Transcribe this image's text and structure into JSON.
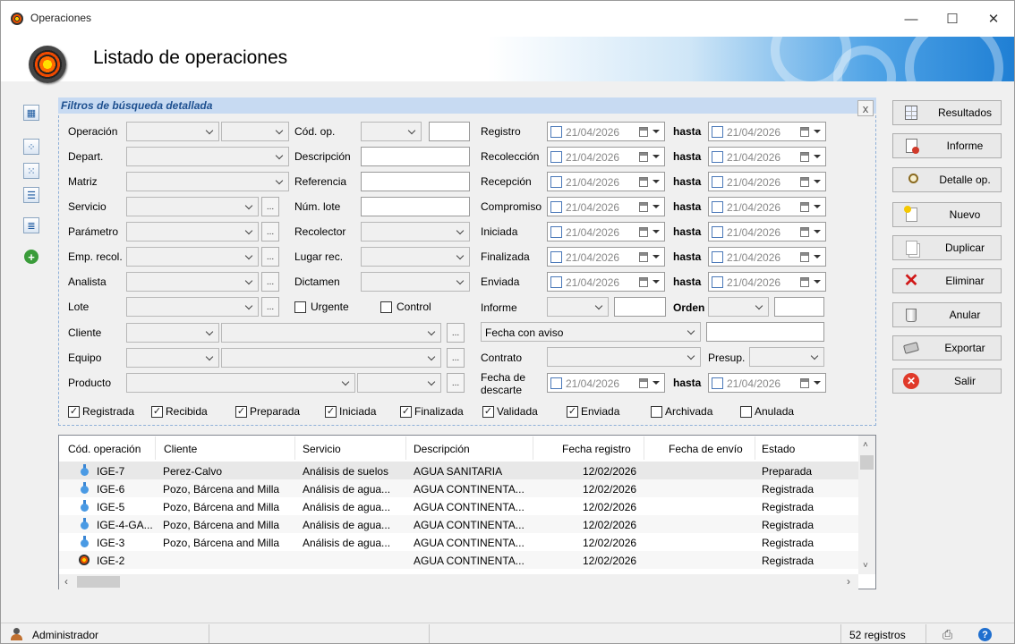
{
  "window": {
    "title": "Operaciones",
    "banner_title": "Listado de operaciones",
    "minimize": "—",
    "maximize": "☐",
    "close": "✕"
  },
  "filters": {
    "title": "Filtros de búsqueda detallada",
    "close": "x",
    "labels": {
      "operacion": "Operación",
      "depart": "Depart.",
      "matriz": "Matriz",
      "servicio": "Servicio",
      "parametro": "Parámetro",
      "emp_recol": "Emp. recol.",
      "analista": "Analista",
      "lote": "Lote",
      "cliente": "Cliente",
      "equipo": "Equipo",
      "producto": "Producto",
      "cod_op": "Cód. op.",
      "descripcion": "Descripción",
      "referencia": "Referencia",
      "num_lote": "Núm. lote",
      "recolector": "Recolector",
      "lugar_rec": "Lugar rec.",
      "dictamen": "Dictamen",
      "urgente": "Urgente",
      "control": "Control",
      "registro": "Registro",
      "recoleccion": "Recolección",
      "recepcion": "Recepción",
      "compromiso": "Compromiso",
      "iniciada": "Iniciada",
      "finalizada": "Finalizada",
      "enviada": "Enviada",
      "informe": "Informe",
      "orden": "Orden",
      "contrato": "Contrato",
      "presup": "Presup.",
      "fecha_descarte_1": "Fecha de",
      "fecha_descarte_2": "descarte",
      "hasta": "hasta"
    },
    "ellipsis": "...",
    "date_value": "21/04/2026",
    "fecha_con_aviso": "Fecha con aviso",
    "status_checks": [
      {
        "label": "Registrada",
        "checked": true
      },
      {
        "label": "Recibida",
        "checked": true
      },
      {
        "label": "Preparada",
        "checked": true
      },
      {
        "label": "Iniciada",
        "checked": true
      },
      {
        "label": "Finalizada",
        "checked": true
      },
      {
        "label": "Validada",
        "checked": true
      },
      {
        "label": "Enviada",
        "checked": true
      },
      {
        "label": "Archivada",
        "checked": false
      },
      {
        "label": "Anulada",
        "checked": false
      }
    ],
    "check_mark": "✓"
  },
  "buttons": [
    "Resultados",
    "Informe",
    "Detalle op.",
    "Nuevo",
    "Duplicar",
    "Eliminar",
    "Anular",
    "Exportar",
    "Salir"
  ],
  "table": {
    "headers": [
      "Cód. operación",
      "Cliente",
      "Servicio",
      "Descripción",
      "Fecha registro",
      "Fecha de envío",
      "Estado"
    ],
    "rows": [
      [
        "IGE-7",
        "Perez-Calvo",
        "Análisis de suelos",
        "AGUA SANITARIA",
        "12/02/2026",
        "",
        "Preparada"
      ],
      [
        "IGE-6",
        "Pozo, Bárcena and Milla",
        "Análisis de agua...",
        "AGUA CONTINENTA...",
        "12/02/2026",
        "",
        "Registrada"
      ],
      [
        "IGE-5",
        "Pozo, Bárcena and Milla",
        "Análisis de agua...",
        "AGUA CONTINENTA...",
        "12/02/2026",
        "",
        "Registrada"
      ],
      [
        "IGE-4-GA...",
        "Pozo, Bárcena and Milla",
        "Análisis de agua...",
        "AGUA CONTINENTA...",
        "12/02/2026",
        "",
        "Registrada"
      ],
      [
        "IGE-3",
        "Pozo, Bárcena and Milla",
        "Análisis de agua...",
        "AGUA CONTINENTA...",
        "12/02/2026",
        "",
        "Registrada"
      ],
      [
        "IGE-2",
        "",
        "",
        "AGUA CONTINENTA...",
        "12/02/2026",
        "",
        "Registrada"
      ]
    ]
  },
  "status": {
    "user": "Administrador",
    "count": "52 registros"
  }
}
